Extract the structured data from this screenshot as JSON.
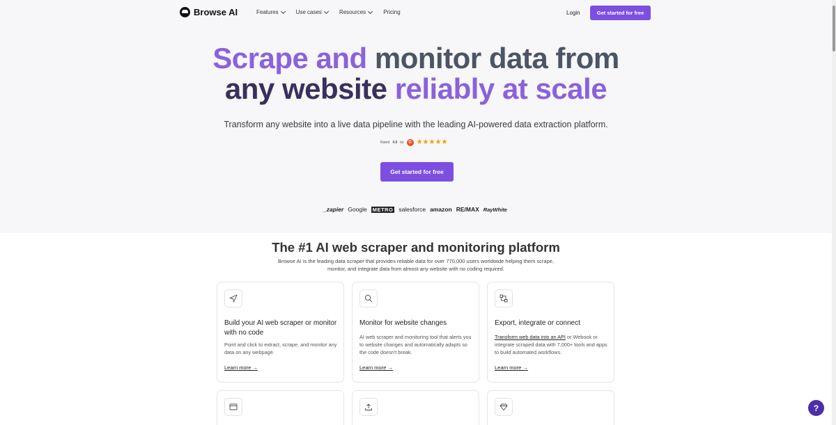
{
  "nav": {
    "brand": "Browse AI",
    "links": [
      "Features",
      "Use cases",
      "Resources",
      "Pricing"
    ],
    "login": "Login",
    "cta": "Get started for free"
  },
  "hero": {
    "headline_part1": "Scrape and ",
    "headline_part2": "monitor data from",
    "headline_part3": "any website ",
    "headline_part4": "reliably at scale",
    "subhead": "Transform any website into a live data pipeline with the leading AI-powered data extraction platform.",
    "rating_prefix": "Rated",
    "rating_value": "4.9",
    "rating_by": "by",
    "rating_source_icon": "G",
    "stars": "★★★★★",
    "cta": "Get started for free",
    "logos": [
      "_zapier",
      "Google",
      "METRO",
      "salesforce",
      "amazon",
      "RE/MAX",
      "RayWhite"
    ]
  },
  "section": {
    "title": "The #1 AI web scraper and monitoring platform",
    "desc": "Browse AI is the leading data scraper that provides reliable data for over 770,000 users worldwide helping them scrape, monitor, and integrate data from almost any website with no coding required.",
    "cards": [
      {
        "title": "Build your AI web scraper or monitor with no code",
        "text": "Point and click to extract, scrape, and monitor any data on any webpage.",
        "link": "Learn more →"
      },
      {
        "title": "Monitor for website changes",
        "text": "AI web scraper and monitoring tool that alerts you to website changes and automatically adapts so the code doesn't break.",
        "link": "Learn more →"
      },
      {
        "title": "Export, integrate or connect",
        "text_link": "Transform web data into an API",
        "text": " or Webook or integrate scraped data with 7,000+ tools and apps to build automated workflows.",
        "link": "Learn more →"
      }
    ]
  },
  "help": "?",
  "colors": {
    "accent": "#7c4fe0",
    "hero_bg": "#f7f6f8",
    "help": "#4b2fa8"
  }
}
